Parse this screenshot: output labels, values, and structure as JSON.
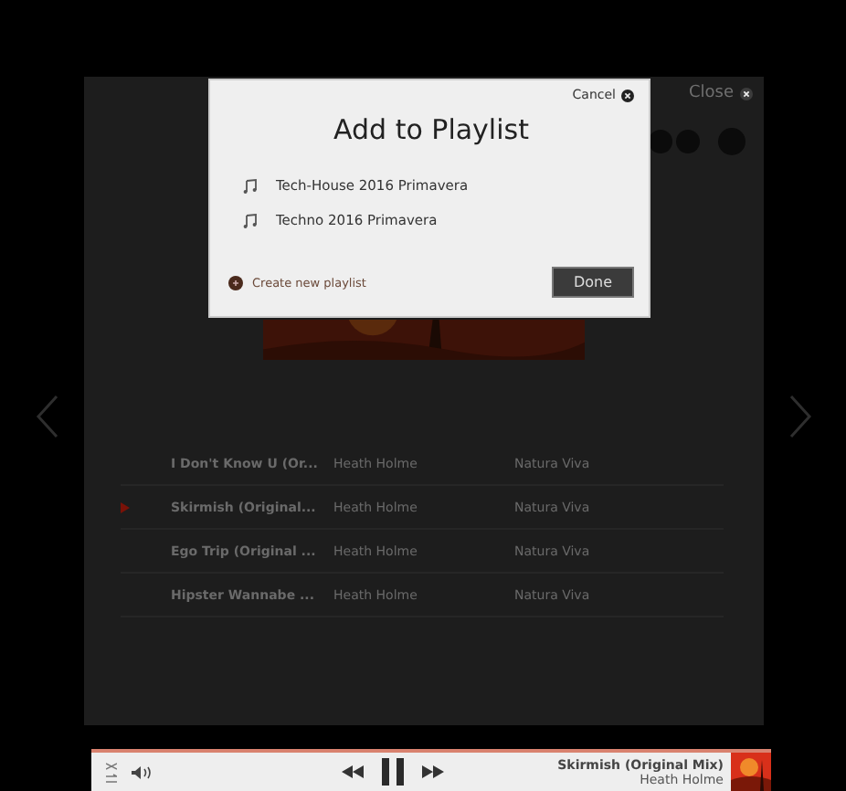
{
  "panel": {
    "close": "Close"
  },
  "tracks": [
    {
      "title": "I Don't Know U (Or...",
      "artist": "Heath Holme",
      "label": "Natura Viva",
      "playing": false
    },
    {
      "title": "Skirmish (Original...",
      "artist": "Heath Holme",
      "label": "Natura Viva",
      "playing": true
    },
    {
      "title": "Ego Trip (Original ...",
      "artist": "Heath Holme",
      "label": "Natura Viva",
      "playing": false
    },
    {
      "title": "Hipster Wannabe ...",
      "artist": "Heath Holme",
      "label": "Natura Viva",
      "playing": false
    }
  ],
  "dialog": {
    "cancel": "Cancel",
    "title": "Add to Playlist",
    "playlists": [
      "Tech-House 2016 Primavera",
      "Techno 2016 Primavera"
    ],
    "create": "Create new playlist",
    "done": "Done"
  },
  "player": {
    "title": "Skirmish (Original Mix)",
    "artist": "Heath Holme"
  }
}
